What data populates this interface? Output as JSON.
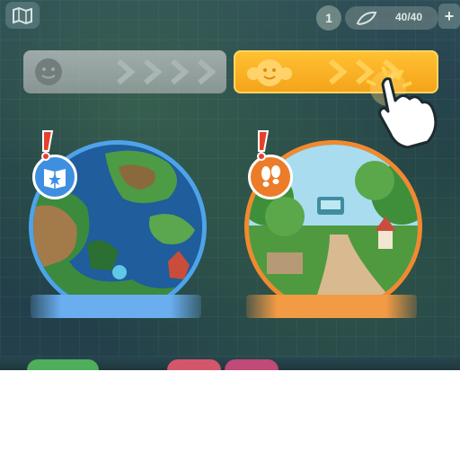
{
  "topbar": {
    "map_icon": "world-map-icon",
    "level": "1",
    "stamina": "40/40",
    "stamina_icon": "leaf-energy-icon",
    "add_label": "+"
  },
  "tabs": [
    {
      "name": "inactive-tab",
      "icon": "face-icon",
      "state": "inactive",
      "color": "#b8bcbc"
    },
    {
      "name": "active-tab",
      "icon": "smiling-creature-icon",
      "state": "active",
      "color": "#f7a91f"
    }
  ],
  "tutorial": {
    "icon": "tap-hand-icon"
  },
  "cards": [
    {
      "name": "world-map-card",
      "badge_icon": "star-book-icon",
      "alert": "!",
      "border_color": "#4ea3ea"
    },
    {
      "name": "walking-path-card",
      "badge_icon": "footprints-icon",
      "alert": "!",
      "border_color": "#f2892e"
    }
  ]
}
